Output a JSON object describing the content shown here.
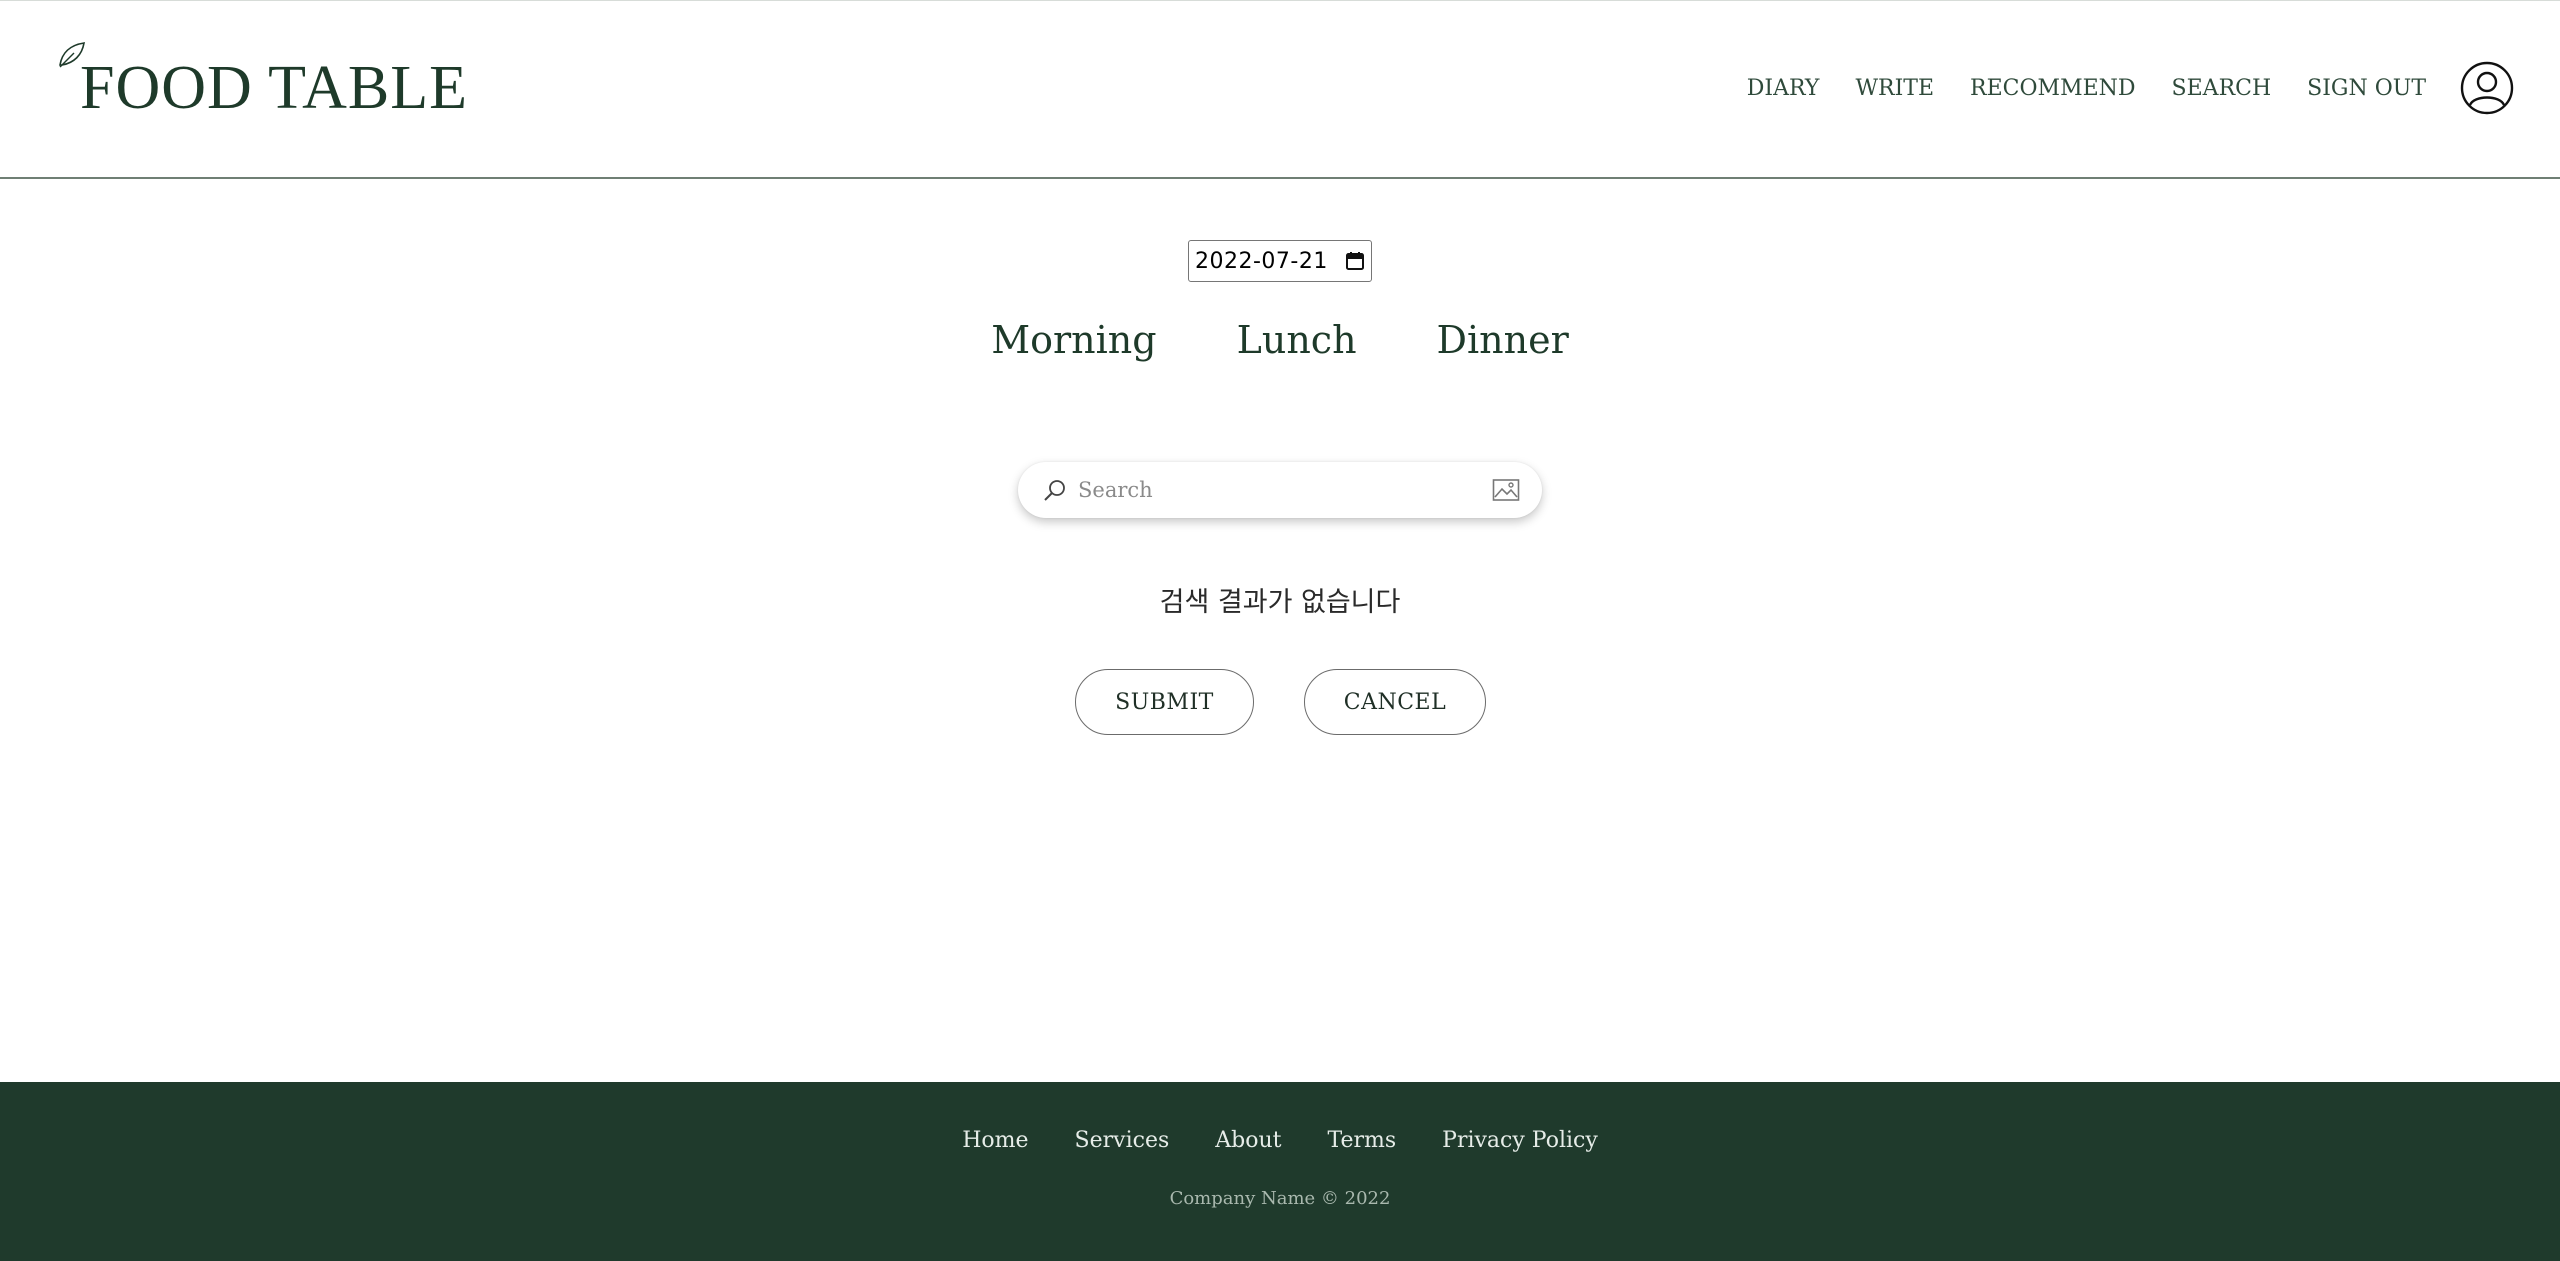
{
  "header": {
    "logo_text": "FOOD TABLE",
    "nav": [
      "DIARY",
      "WRITE",
      "RECOMMEND",
      "SEARCH",
      "SIGN OUT"
    ]
  },
  "main": {
    "date_value": "2022-07-21",
    "meal_tabs": [
      "Morning",
      "Lunch",
      "Dinner"
    ],
    "search": {
      "placeholder": "Search",
      "value": ""
    },
    "no_result_text": "검색 결과가 없습니다",
    "submit_label": "SUBMIT",
    "cancel_label": "CANCEL"
  },
  "footer": {
    "links": [
      "Home",
      "Services",
      "About",
      "Terms",
      "Privacy Policy"
    ],
    "copyright": "Company Name © 2022"
  },
  "colors": {
    "brand_green": "#1e3a2a",
    "footer_bg": "#1f3a2c"
  },
  "icons": {
    "logo": "leaf-icon",
    "avatar": "user-circle-icon",
    "search": "search-icon",
    "image": "image-icon",
    "calendar": "calendar-icon"
  }
}
